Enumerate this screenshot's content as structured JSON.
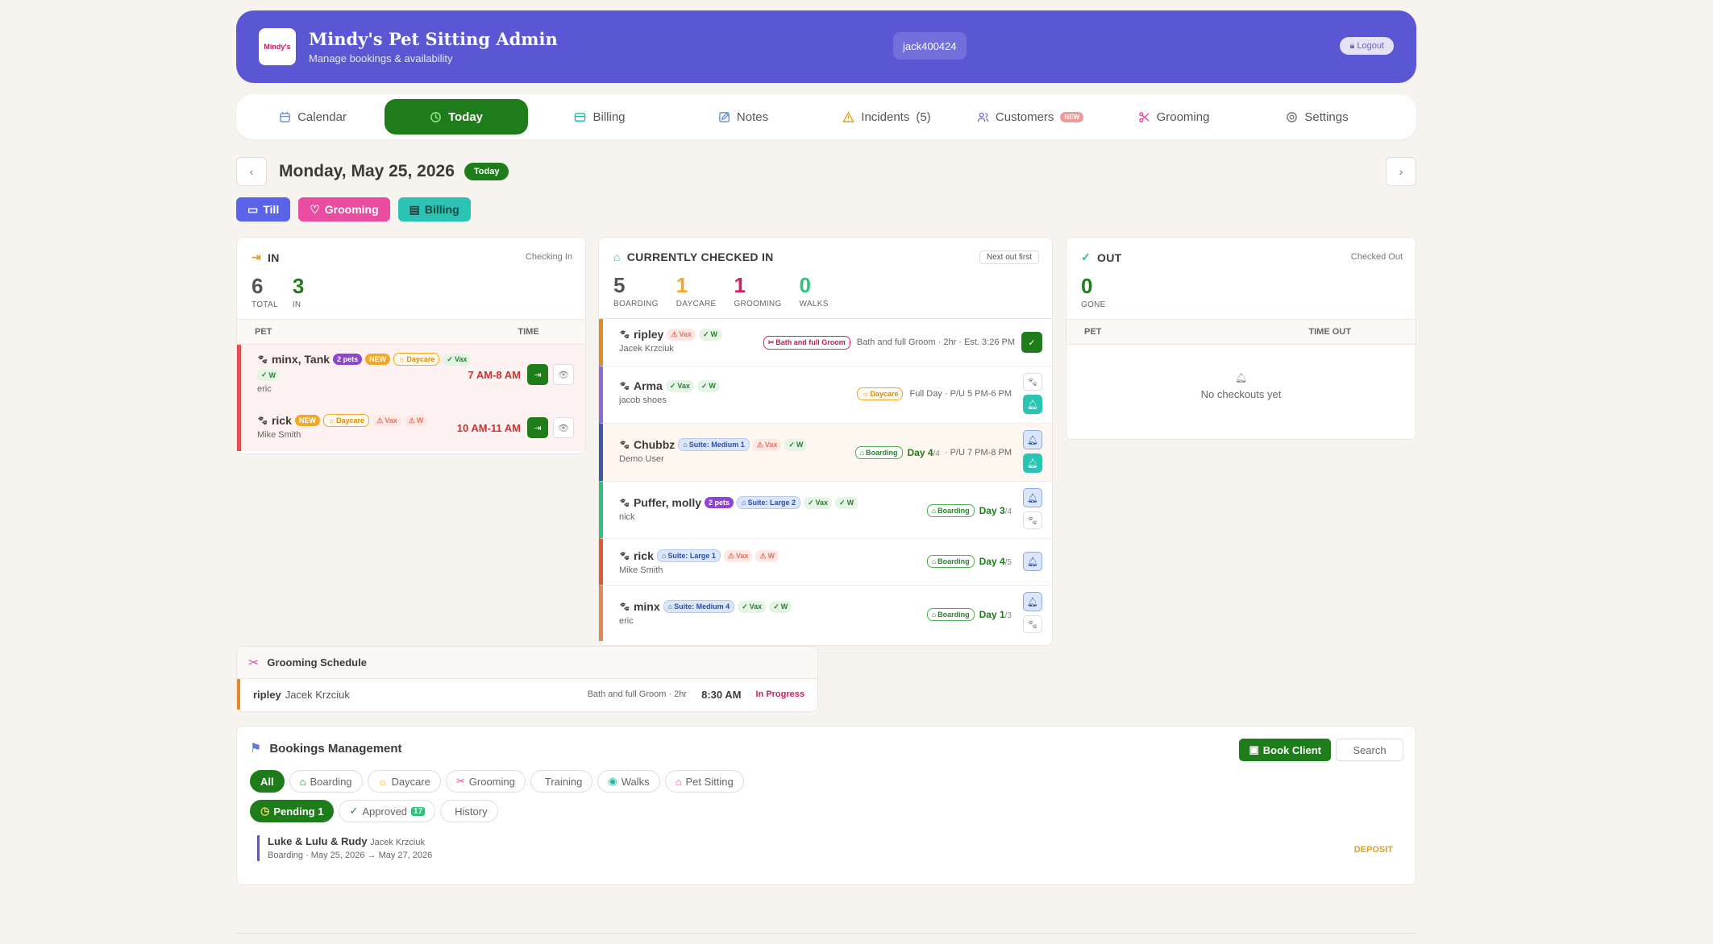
{
  "header": {
    "logo_text": "Mindy's",
    "title": "Mindy's Pet Sitting Admin",
    "subtitle": "Manage bookings & availability",
    "user": "jack400424",
    "logout": "Logout"
  },
  "nav": {
    "calendar": "Calendar",
    "today": "Today",
    "billing": "Billing",
    "notes": "Notes",
    "incidents": "Incidents",
    "incidents_count": "(5)",
    "customers": "Customers",
    "customers_badge": "NEW",
    "grooming": "Grooming",
    "settings": "Settings"
  },
  "date": {
    "title": "Monday, May 25, 2026",
    "badge": "Today",
    "prev": "‹",
    "next": "›"
  },
  "quick": {
    "till": "Till",
    "grooming": "Grooming",
    "billing": "Billing"
  },
  "in_card": {
    "title": "IN",
    "tag": "Checking In",
    "total": "6",
    "total_label": "TOTAL",
    "in": "3",
    "in_label": "IN",
    "col_pet": "PET",
    "col_time": "TIME",
    "rows": [
      {
        "pets": "minx, Tank",
        "count": "2 pets",
        "new": "NEW",
        "service": "Daycare",
        "vax": "Vax",
        "w": "W",
        "owner": "eric",
        "time": "7 AM-8 AM"
      },
      {
        "pets": "rick",
        "new": "NEW",
        "service": "Daycare",
        "vax": "Vax",
        "w": "W",
        "owner": "Mike Smith",
        "time": "10 AM-11 AM"
      }
    ]
  },
  "checked_card": {
    "title": "CURRENTLY CHECKED IN",
    "tag": "Next out first",
    "boarding": "5",
    "boarding_label": "BOARDING",
    "daycare": "1",
    "daycare_label": "DAYCARE",
    "grooming": "1",
    "grooming_label": "GROOMING",
    "walks": "0",
    "walks_label": "WALKS",
    "rows": [
      {
        "pet": "ripley",
        "vax": "Vax",
        "w": "W",
        "owner": "Jacek Krzciuk",
        "service": "Bath and full Groom",
        "detail": "Bath and full Groom · 2hr · Est. 3:26 PM"
      },
      {
        "pet": "Arma",
        "vax": "Vax",
        "w": "W",
        "owner": "jacob shoes",
        "service": "Daycare",
        "detail": "Full Day · P/U 5 PM-6 PM"
      },
      {
        "pet": "Chubbz",
        "suite": "Suite: Medium 1",
        "vax": "Vax",
        "w": "W",
        "owner": "Demo User",
        "service": "Boarding",
        "day": "Day 4",
        "day_of": "/4",
        "detail": "· P/U 7 PM-8 PM"
      },
      {
        "pet": "Puffer, molly",
        "count": "2 pets",
        "suite": "Suite: Large 2",
        "vax": "Vax",
        "w": "W",
        "owner": "nick",
        "service": "Boarding",
        "day": "Day 3",
        "day_of": "/4"
      },
      {
        "pet": "rick",
        "suite": "Suite: Large 1",
        "vax": "Vax",
        "w": "W",
        "owner": "Mike Smith",
        "service": "Boarding",
        "day": "Day 4",
        "day_of": "/5"
      },
      {
        "pet": "minx",
        "suite": "Suite: Medium 4",
        "vax": "Vax",
        "w": "W",
        "owner": "eric",
        "service": "Boarding",
        "day": "Day 1",
        "day_of": "/3"
      }
    ]
  },
  "out_card": {
    "title": "OUT",
    "tag": "Checked Out",
    "gone": "0",
    "gone_label": "GONE",
    "col_pet": "PET",
    "col_time": "TIME OUT",
    "empty": "No checkouts yet"
  },
  "grooming_schedule": {
    "title": "Grooming Schedule",
    "pet": "ripley",
    "owner": "Jacek Krzciuk",
    "service": "Bath and full Groom · 2hr",
    "time": "8:30 AM",
    "status": "In Progress"
  },
  "bookings": {
    "title": "Bookings Management",
    "book_client": "Book Client",
    "search": "Search",
    "filters": [
      "All",
      "Boarding",
      "Daycare",
      "Grooming",
      "Training",
      "Walks",
      "Pet Sitting"
    ],
    "status_pending": "Pending 1",
    "status_approved": "Approved",
    "approved_count": "17",
    "status_history": "History",
    "item_pets": "Luke & Lulu & Rudy",
    "item_owner": "Jacek Krzciuk",
    "item_detail": "Boarding · May 25, 2026 → May 27, 2026",
    "item_status": "DEPOSIT"
  },
  "colors": {
    "header": "#5b56d4",
    "active": "#1e7d1a",
    "till": "#5b56d4",
    "grooming": "#e94ca0",
    "billing": "#2bc4b4"
  }
}
